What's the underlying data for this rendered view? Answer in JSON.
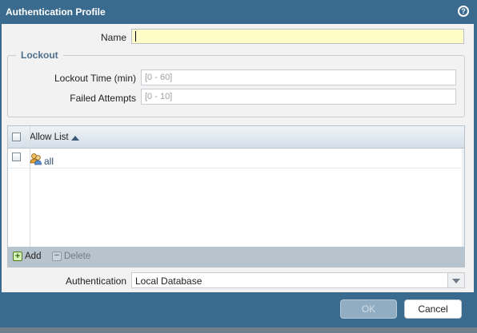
{
  "dialog": {
    "title": "Authentication Profile"
  },
  "form": {
    "name_label": "Name",
    "name_value": "",
    "lockout": {
      "legend": "Lockout",
      "time_label": "Lockout Time (min)",
      "time_placeholder": "[0 - 60]",
      "attempts_label": "Failed Attempts",
      "attempts_placeholder": "[0 - 10]"
    },
    "allow_list": {
      "header": "Allow List",
      "rows": [
        {
          "label": "all",
          "icon": "users-icon"
        }
      ],
      "add_label": "Add",
      "delete_label": "Delete"
    },
    "authentication": {
      "label": "Authentication",
      "value": "Local Database"
    }
  },
  "buttons": {
    "ok": "OK",
    "cancel": "Cancel"
  },
  "colors": {
    "titlebar": "#3a6b8e",
    "name_field_bg": "#fffdc7",
    "legend": "#4d6f8c"
  }
}
